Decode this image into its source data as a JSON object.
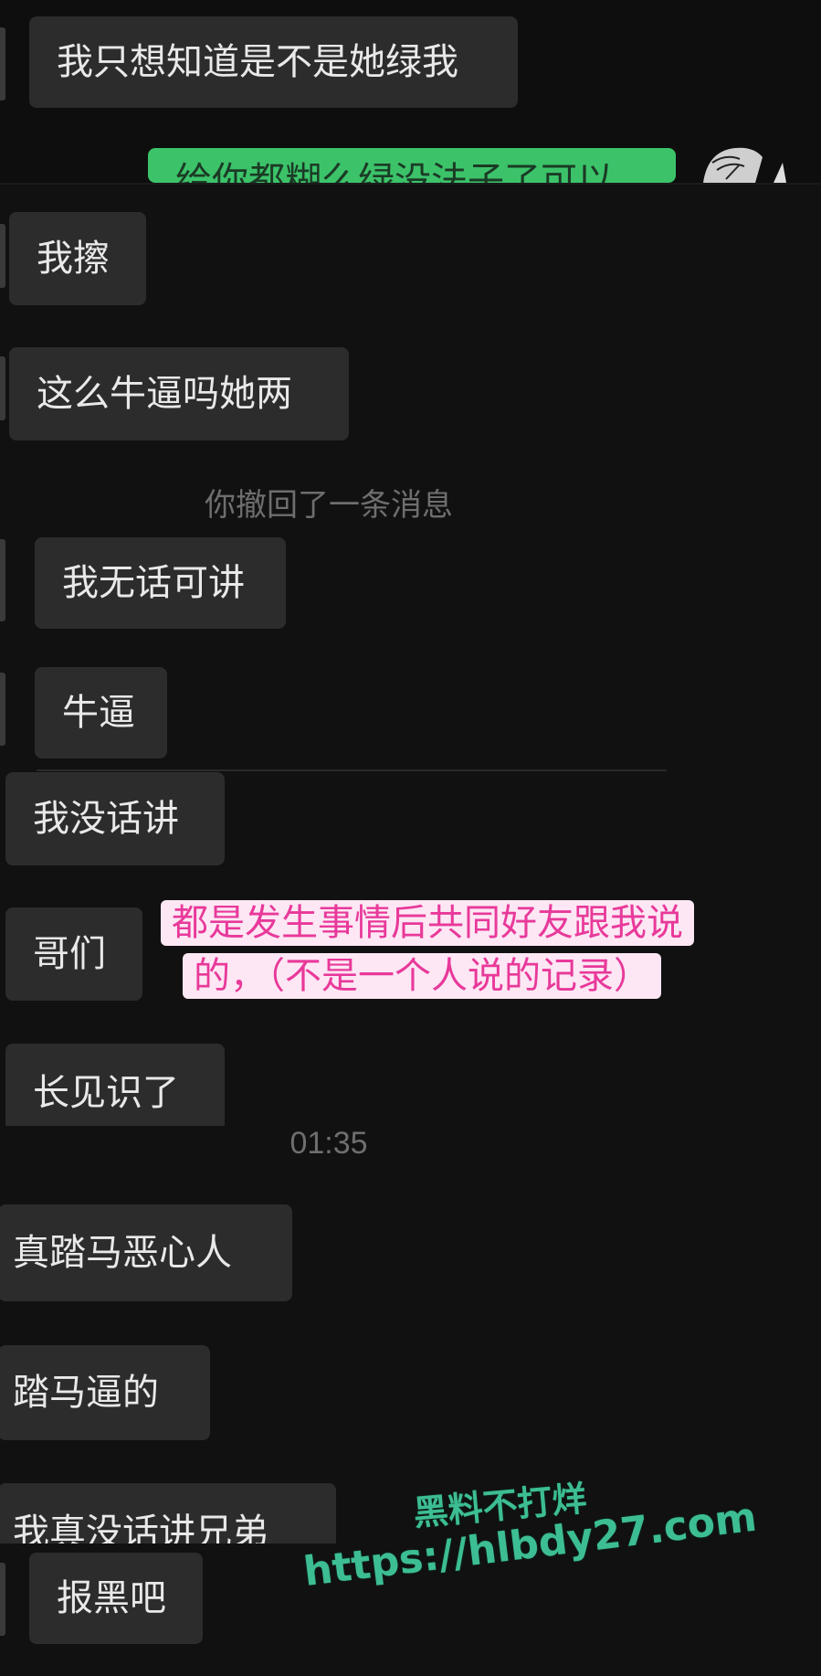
{
  "chat": {
    "messages": [
      {
        "id": "m1",
        "text": "我只想知道是不是她绿我"
      },
      {
        "id": "m2",
        "text": "给你都糊么绿没法子了可以"
      },
      {
        "id": "m3",
        "text": "我擦"
      },
      {
        "id": "m4",
        "text": "这么牛逼吗她两"
      },
      {
        "id": "m5",
        "text": "我无话可讲"
      },
      {
        "id": "m6",
        "text": "牛逼"
      },
      {
        "id": "m7",
        "text": "我没话讲"
      },
      {
        "id": "m8",
        "text": "哥们"
      },
      {
        "id": "m9",
        "text": "长见识了"
      },
      {
        "id": "m10",
        "text": "真踏马恶心人"
      },
      {
        "id": "m11",
        "text": "踏马逼的"
      },
      {
        "id": "m12",
        "text": "我真没话讲兄弟"
      },
      {
        "id": "m13",
        "text": "报黑吧"
      }
    ],
    "system_recall": "你撤回了一条消息",
    "timestamp": "01:35"
  },
  "overlay_note": {
    "line1": "都是发生事情后共同好友跟我说",
    "line2": "的，（不是一个人说的记录）"
  },
  "watermark": {
    "line1": "黑料不打烊",
    "line2": "https://hlbdy27.com"
  },
  "colors": {
    "background": "#111111",
    "bubble_received": "#2c2c2c",
    "bubble_sent": "#3cc36a",
    "note_text": "#e8399a",
    "note_background": "#fde7f4",
    "watermark": "#3dbd93"
  }
}
